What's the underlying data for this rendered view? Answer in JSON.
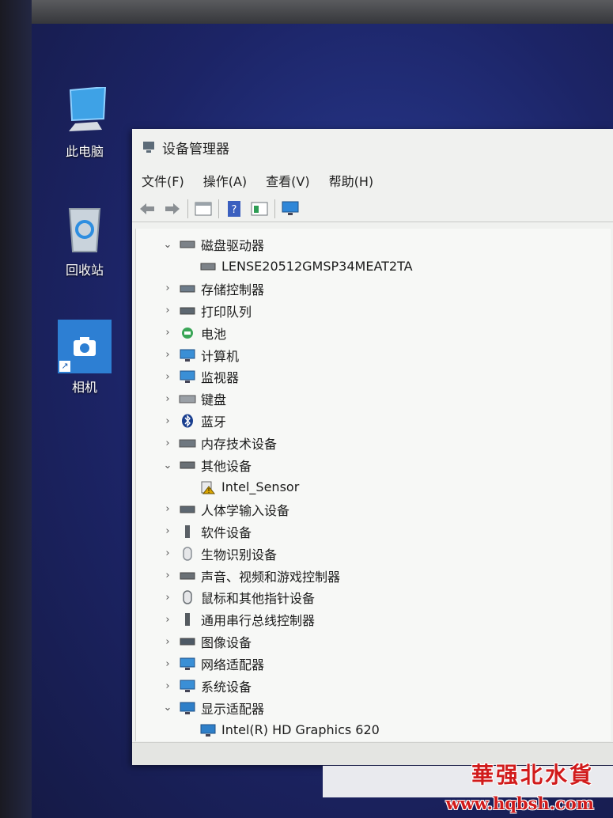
{
  "desktop": {
    "icons": [
      {
        "label": "此电脑",
        "icon": "computer-icon"
      },
      {
        "label": "回收站",
        "icon": "recycle-bin-icon"
      },
      {
        "label": "相机",
        "icon": "camera-icon"
      }
    ]
  },
  "window": {
    "title": "设备管理器",
    "menu": [
      "文件(F)",
      "操作(A)",
      "查看(V)",
      "帮助(H)"
    ],
    "toolbar": [
      "back-icon",
      "forward-icon",
      "properties-icon",
      "help-icon",
      "view-icon",
      "monitor-icon"
    ],
    "tree": [
      {
        "label": "磁盘驱动器",
        "expanded": true,
        "icon": "disk-icon"
      },
      {
        "label": "LENSE20512GMSP34MEAT2TA",
        "child": true,
        "icon": "disk-icon"
      },
      {
        "label": "存储控制器",
        "expanded": false,
        "icon": "storage-controller-icon"
      },
      {
        "label": "打印队列",
        "expanded": false,
        "icon": "printer-icon"
      },
      {
        "label": "电池",
        "expanded": false,
        "icon": "battery-icon"
      },
      {
        "label": "计算机",
        "expanded": false,
        "icon": "computer-icon"
      },
      {
        "label": "监视器",
        "expanded": false,
        "icon": "monitor-icon"
      },
      {
        "label": "键盘",
        "expanded": false,
        "icon": "keyboard-icon"
      },
      {
        "label": "蓝牙",
        "expanded": false,
        "icon": "bluetooth-icon"
      },
      {
        "label": "内存技术设备",
        "expanded": false,
        "icon": "memory-icon"
      },
      {
        "label": "其他设备",
        "expanded": true,
        "icon": "unknown-device-icon"
      },
      {
        "label": "Intel_Sensor",
        "child": true,
        "icon": "warning-device-icon"
      },
      {
        "label": "人体学输入设备",
        "expanded": false,
        "icon": "hid-icon"
      },
      {
        "label": "软件设备",
        "expanded": false,
        "icon": "software-device-icon"
      },
      {
        "label": "生物识别设备",
        "expanded": false,
        "icon": "fingerprint-icon"
      },
      {
        "label": "声音、视频和游戏控制器",
        "expanded": false,
        "icon": "speaker-icon"
      },
      {
        "label": "鼠标和其他指针设备",
        "expanded": false,
        "icon": "mouse-icon"
      },
      {
        "label": "通用串行总线控制器",
        "expanded": false,
        "icon": "usb-icon"
      },
      {
        "label": "图像设备",
        "expanded": false,
        "icon": "camera-icon"
      },
      {
        "label": "网络适配器",
        "expanded": false,
        "icon": "network-icon"
      },
      {
        "label": "系统设备",
        "expanded": false,
        "icon": "system-device-icon"
      },
      {
        "label": "显示适配器",
        "expanded": true,
        "icon": "display-adapter-icon"
      },
      {
        "label": "Intel(R) HD Graphics 620",
        "child": true,
        "icon": "display-adapter-icon"
      }
    ]
  },
  "watermark": {
    "text": "華强北水貨",
    "url": "www.hqbsh.com"
  }
}
